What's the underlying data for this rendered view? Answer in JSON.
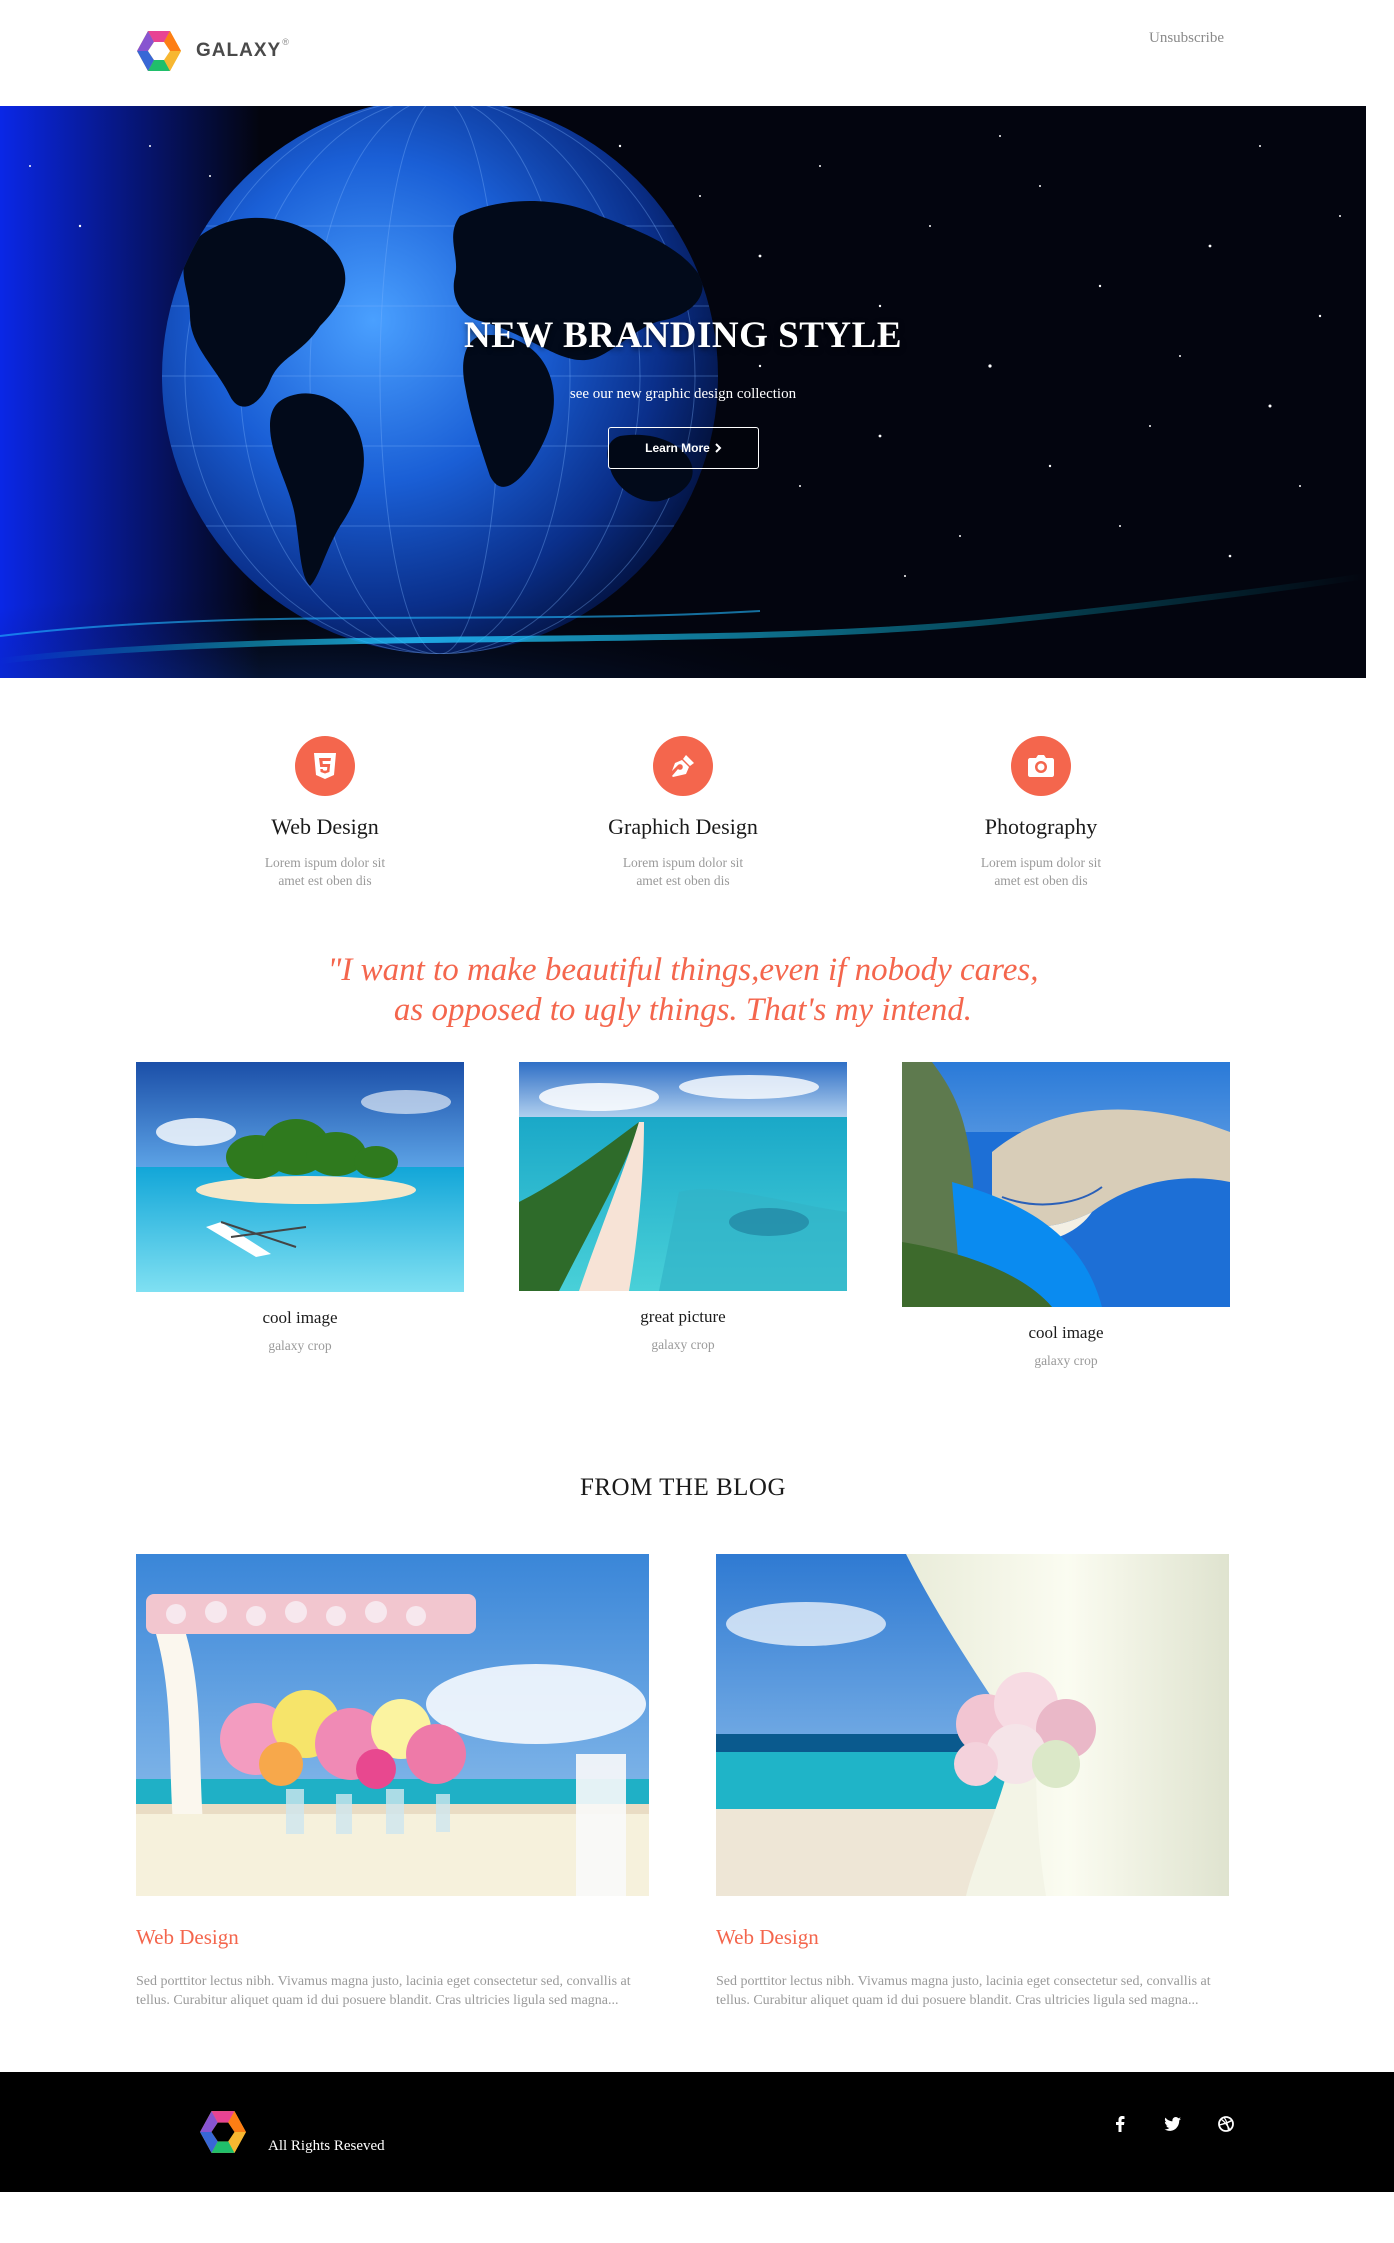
{
  "header": {
    "brand": "GALAXY",
    "brand_mark": "®",
    "unsubscribe": "Unsubscribe"
  },
  "hero": {
    "title": "NEW BRANDING STYLE",
    "subtitle": "see our new graphic design collection",
    "button_label": "Learn More",
    "button_icon": "chevron-right-icon"
  },
  "features": [
    {
      "icon": "html5-icon",
      "title": "Web Design",
      "desc": "Lorem ispum dolor sit amet est oben dis"
    },
    {
      "icon": "pen-nib-icon",
      "title": "Graphich Design",
      "desc": "Lorem ispum dolor sit amet est oben dis"
    },
    {
      "icon": "camera-icon",
      "title": "Photography",
      "desc": "Lorem ispum dolor sit amet est oben dis"
    }
  ],
  "quote": {
    "line1": "\"I want to make beautiful things,even if nobody cares,",
    "line2": "as opposed to ugly things. That's my intend."
  },
  "gallery": [
    {
      "title": "cool image",
      "subtitle": "galaxy crop"
    },
    {
      "title": "great picture",
      "subtitle": "galaxy crop"
    },
    {
      "title": "cool image",
      "subtitle": "galaxy crop"
    }
  ],
  "blog": {
    "heading": "FROM THE BLOG",
    "posts": [
      {
        "title": "Web Design",
        "text": "Sed porttitor lectus nibh. Vivamus magna justo, lacinia eget consectetur sed, convallis at tellus. Curabitur aliquet quam id dui posuere blandit. Cras ultricies ligula sed magna..."
      },
      {
        "title": "Web Design",
        "text": "Sed porttitor lectus nibh. Vivamus magna justo, lacinia eget consectetur sed, convallis at tellus. Curabitur aliquet quam id dui posuere blandit. Cras ultricies ligula sed magna..."
      }
    ]
  },
  "footer": {
    "rights": "All Rights Reseved",
    "social": [
      "facebook-icon",
      "twitter-icon",
      "dribbble-icon"
    ]
  },
  "colors": {
    "accent": "#f4664d",
    "muted": "#9a9a9a",
    "footer_bg": "#000000"
  }
}
